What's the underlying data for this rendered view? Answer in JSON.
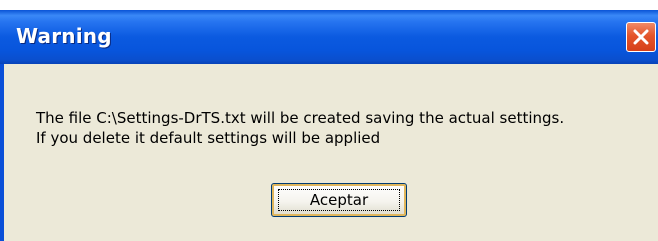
{
  "dialog": {
    "title": "Warning",
    "message_line1": "The file C:\\Settings-DrTS.txt will be created saving the actual settings.",
    "message_line2": "If you delete it default settings will be applied",
    "ok_label": "Aceptar",
    "close_icon": "close-icon"
  },
  "colors": {
    "titlebar": "#0a55dc",
    "close_button": "#e4552b",
    "client_background": "#ece9d8",
    "button_focus": "#e0b65c"
  }
}
